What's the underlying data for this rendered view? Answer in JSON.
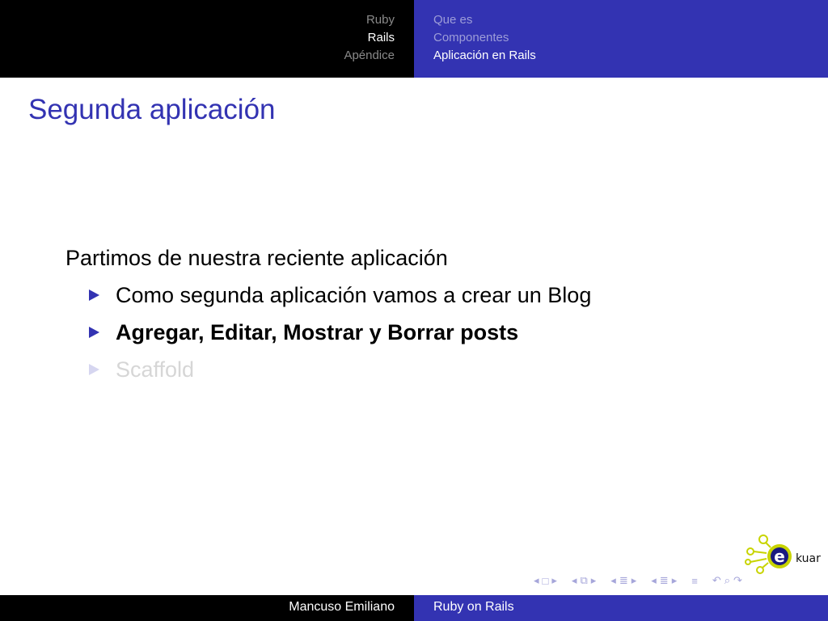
{
  "headline": {
    "sections": [
      {
        "label": "Ruby",
        "active": false
      },
      {
        "label": "Rails",
        "active": true
      },
      {
        "label": "Apéndice",
        "active": false
      }
    ],
    "subsections": [
      {
        "label": "Que es",
        "active": false
      },
      {
        "label": "Componentes",
        "active": false
      },
      {
        "label": "Aplicación en Rails",
        "active": true
      }
    ]
  },
  "frame": {
    "title": "Segunda aplicación",
    "lead": "Partimos de nuestra reciente aplicación",
    "bullets": [
      {
        "text": "Como segunda aplicación vamos a crear un Blog",
        "state": "normal"
      },
      {
        "text": "Agregar, Editar, Mostrar y Borrar posts",
        "state": "highlighted"
      },
      {
        "text": "Scaffold",
        "state": "faded"
      }
    ]
  },
  "logo": {
    "text": "kuar",
    "letter": "e"
  },
  "nav_icons": [
    "prev-arrow-icon",
    "frame-icon",
    "next-arrow-icon",
    "prev-arrow-icon",
    "subsection-icon",
    "next-arrow-icon",
    "prev-arrow-icon",
    "section-icon",
    "next-arrow-icon",
    "prev-arrow-icon",
    "presentation-icon",
    "next-arrow-icon",
    "align-icon",
    "back-icon",
    "search-icon",
    "forward-icon"
  ],
  "footline": {
    "author": "Mancuso Emiliano",
    "title": "Ruby on Rails"
  },
  "colors": {
    "structure": "#3333b2",
    "headline_left": "#000000"
  }
}
